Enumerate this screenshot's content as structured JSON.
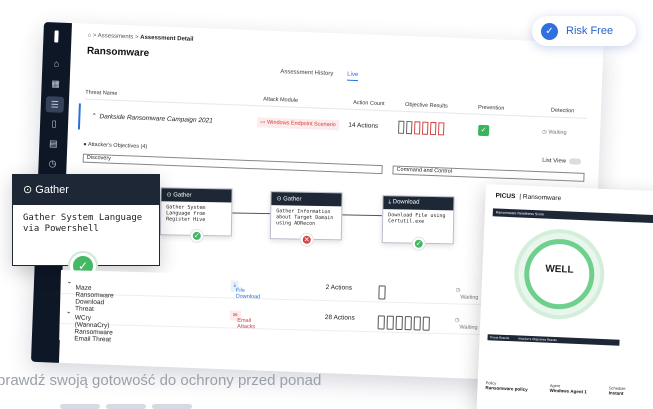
{
  "pill": {
    "label": "Risk Free"
  },
  "breadcrumb": {
    "home": "⌂",
    "sep": ">",
    "c1": "Assessments",
    "c2": "Assessment Detail"
  },
  "page": {
    "title": "Ransomware"
  },
  "tabs": [
    {
      "label": "Assessment History"
    },
    {
      "label": "Live"
    }
  ],
  "table": {
    "headers": [
      "Threat Name",
      "Attack Module",
      "Action Count",
      "Objective Results",
      "Prevention",
      "Detection"
    ],
    "row1": {
      "name": "Darkside Ransomware Campaign 2021",
      "module": "Windows Endpoint Scenario",
      "count": "14 Actions",
      "detection": "Waiting"
    },
    "objectives": "Attacker's Objectives (4)",
    "list_view": "List View",
    "stage1": "Discovery",
    "stage2": "Command and Control",
    "row2": {
      "name": "Maze Ransomware Download Threat",
      "module": "File Download",
      "count": "2 Actions",
      "detection": "Waiting"
    },
    "row3": {
      "name": "WCry (WannaCry) Ransomware Email Threat",
      "module": "Email Attacks",
      "count": "28 Actions",
      "detection": "Waiting"
    }
  },
  "gather_card": {
    "title": "Gather",
    "body": "Gather System Language via Powershell"
  },
  "nodes": [
    {
      "title": "Gather",
      "body": "Gather System Language from Register Hive",
      "status": "green"
    },
    {
      "title": "Gather",
      "body": "Gather Information about Target Domain using ADRecon",
      "status": "red"
    },
    {
      "title": "Download",
      "body": "Download File using Certutil.exe",
      "status": "green"
    }
  ],
  "report": {
    "brand": "PICUS",
    "brand_sub": "Ransomware",
    "score_bar": "Ransomware Readiness Score",
    "score": "WELL",
    "tbl1": "Threat Results",
    "tbl2": "Attacker's Objectives Results",
    "foot": [
      {
        "label": "Policy",
        "value": "Ransomware policy"
      },
      {
        "label": "Agent",
        "value": "Windows Agent 1"
      },
      {
        "label": "Schedule",
        "value": "Instant"
      }
    ]
  },
  "footer": {
    "line1": "prawdź swoją gotowość do ochrony przed ponad"
  },
  "colors": {
    "accent": "#2f6fe0",
    "dark": "#1d2735",
    "success": "#45b864",
    "danger": "#d24545"
  }
}
